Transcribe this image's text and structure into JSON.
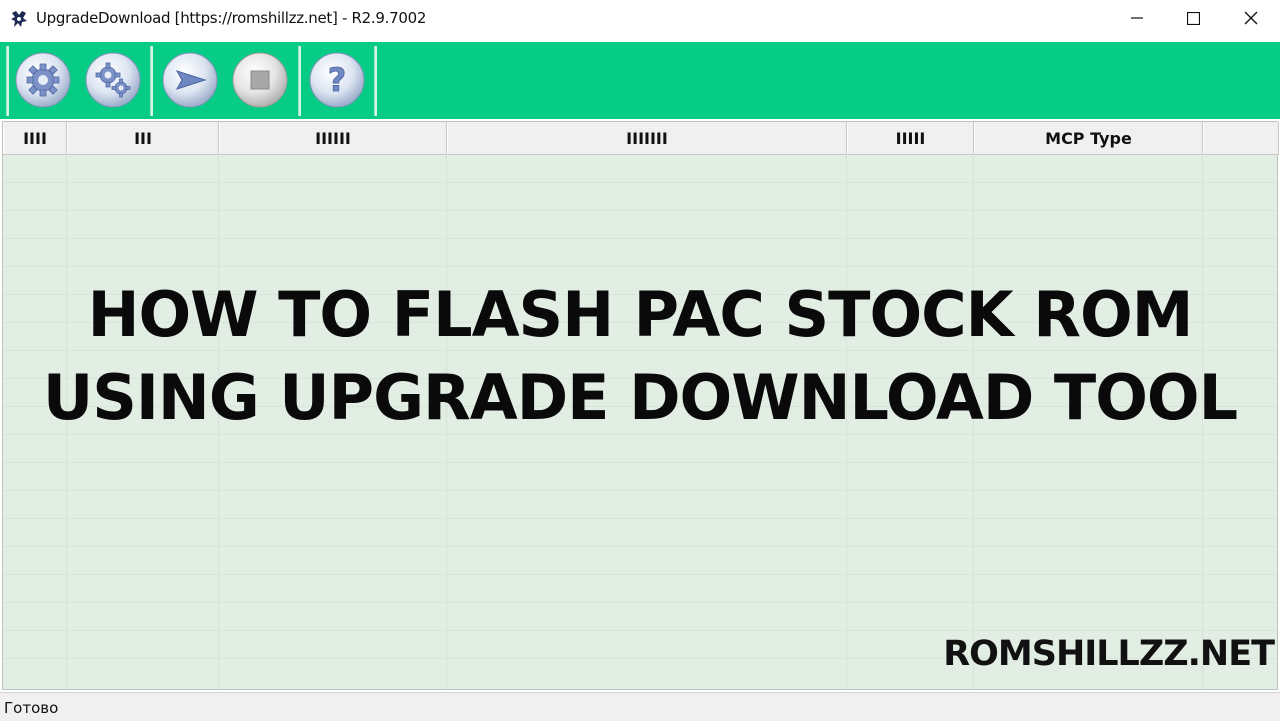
{
  "window": {
    "title": "UpgradeDownload [https://romshillzz.net] - R2.9.7002",
    "controls": [
      "minimize-icon",
      "maximize-icon",
      "close-icon"
    ]
  },
  "toolbar": {
    "buttons": [
      {
        "name": "load-packet-button",
        "icon": "gear-icon"
      },
      {
        "name": "settings-button",
        "icon": "gears-icon"
      },
      {
        "name": "start-download-button",
        "icon": "play-arrow-icon"
      },
      {
        "name": "stop-download-button",
        "icon": "stop-icon"
      },
      {
        "name": "help-button",
        "icon": "question-icon"
      }
    ],
    "colors": {
      "background": "#07cc86"
    }
  },
  "table": {
    "columns": [
      "IIII",
      "III",
      "IIIIII",
      "IIIIIII",
      "IIIII",
      "MCP Type",
      ""
    ]
  },
  "overlay": {
    "headline_line1": "HOW TO FLASH PAC STOCK ROM",
    "headline_line2": "USING UPGRADE DOWNLOAD TOOL",
    "brand": "ROMSHILLZZ.NET"
  },
  "status": {
    "text": "Готово"
  }
}
